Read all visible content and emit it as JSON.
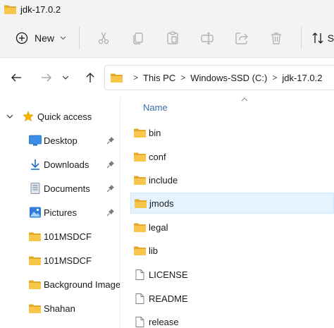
{
  "window": {
    "title": "jdk-17.0.2"
  },
  "toolbar": {
    "new_label": "New",
    "sort_label": "S",
    "icons": [
      "cut-icon",
      "copy-icon",
      "paste-icon",
      "rename-icon",
      "share-icon",
      "delete-icon",
      "sort-icon"
    ]
  },
  "address": {
    "crumbs": [
      "This PC",
      "Windows-SSD (C:)",
      "jdk-17.0.2"
    ],
    "separator": ">"
  },
  "sidebar": {
    "quick_access": "Quick access",
    "items": [
      {
        "label": "Desktop",
        "icon": "desktop-icon",
        "pinned": true
      },
      {
        "label": "Downloads",
        "icon": "download-icon",
        "pinned": true
      },
      {
        "label": "Documents",
        "icon": "document-icon",
        "pinned": true
      },
      {
        "label": "Pictures",
        "icon": "pictures-icon",
        "pinned": true
      },
      {
        "label": "101MSDCF",
        "icon": "folder-icon",
        "pinned": false
      },
      {
        "label": "101MSDCF",
        "icon": "folder-icon",
        "pinned": false
      },
      {
        "label": "Background Images",
        "icon": "folder-icon",
        "pinned": false
      },
      {
        "label": "Shahan",
        "icon": "folder-icon",
        "pinned": false
      }
    ]
  },
  "files": {
    "column_name": "Name",
    "selected_index": 3,
    "items": [
      {
        "name": "bin",
        "type": "folder"
      },
      {
        "name": "conf",
        "type": "folder"
      },
      {
        "name": "include",
        "type": "folder"
      },
      {
        "name": "jmods",
        "type": "folder"
      },
      {
        "name": "legal",
        "type": "folder"
      },
      {
        "name": "lib",
        "type": "folder"
      },
      {
        "name": "LICENSE",
        "type": "file"
      },
      {
        "name": "README",
        "type": "file"
      },
      {
        "name": "release",
        "type": "file"
      }
    ]
  },
  "colors": {
    "folder": "#f7c64b",
    "folder_dark": "#e3a92a",
    "accent": "#0067c0",
    "selection": "#e5f3ff",
    "header_text": "#3a6ea5"
  }
}
